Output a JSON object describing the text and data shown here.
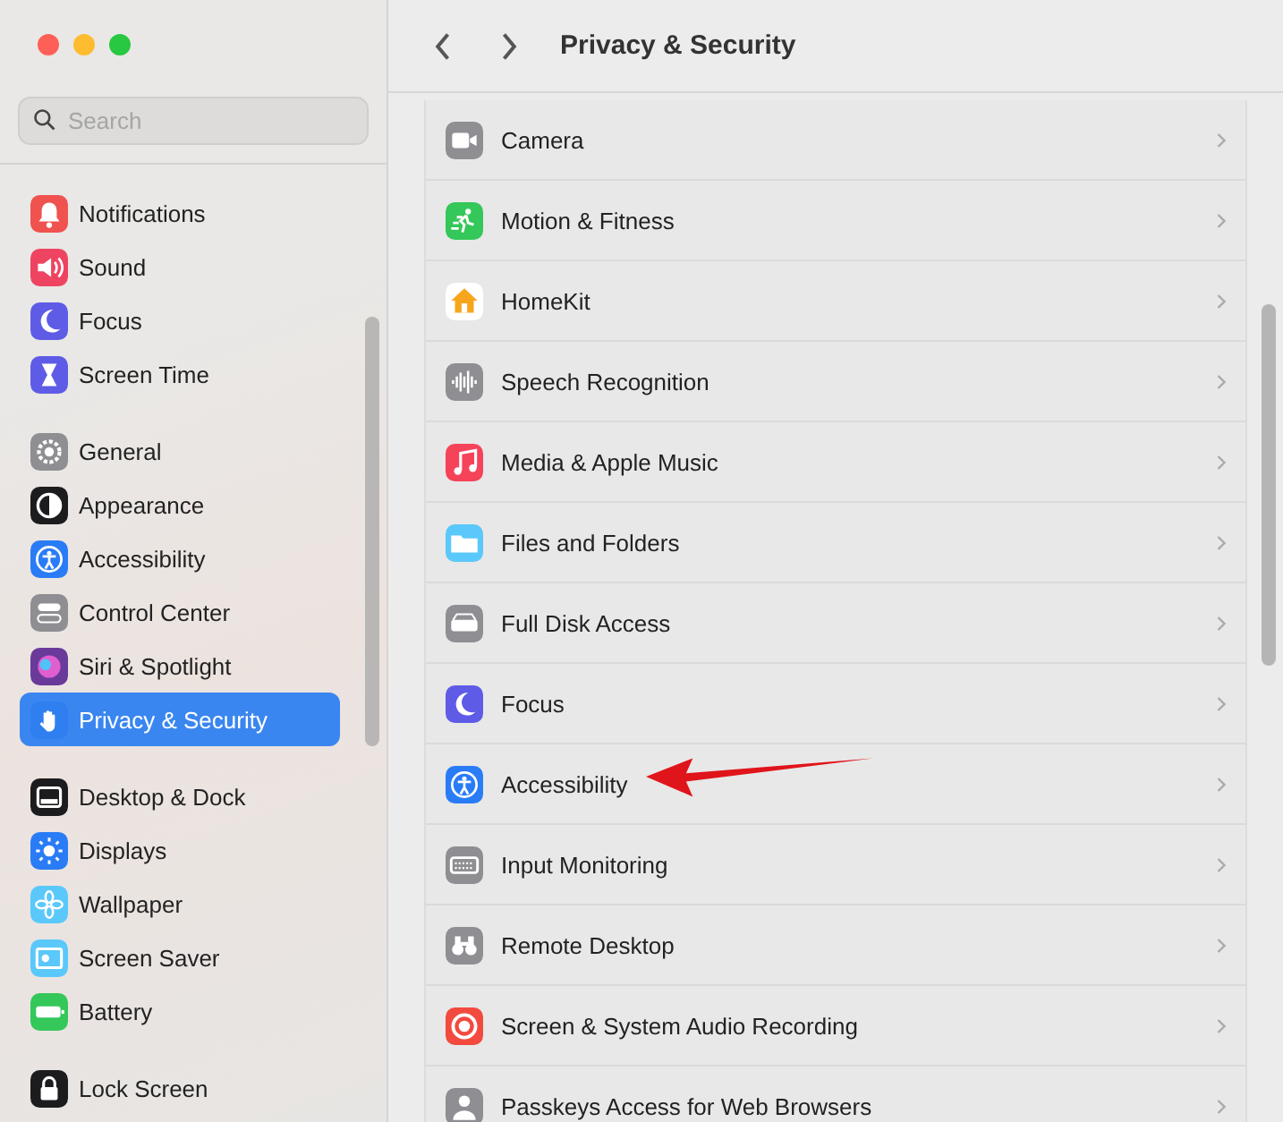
{
  "sidebar": {
    "search": {
      "placeholder": "Search"
    },
    "groups": [
      {
        "items": [
          {
            "label": "Notifications",
            "color": "#f0524f",
            "selected": false
          },
          {
            "label": "Sound",
            "color": "#ef4461",
            "selected": false
          },
          {
            "label": "Focus",
            "color": "#5e5ce6",
            "selected": false
          },
          {
            "label": "Screen Time",
            "color": "#5e5ce6",
            "selected": false
          }
        ]
      },
      {
        "items": [
          {
            "label": "General",
            "color": "#8e8e93",
            "selected": false
          },
          {
            "label": "Appearance",
            "color": "#1c1c1e",
            "selected": false
          },
          {
            "label": "Accessibility",
            "color": "#2a7cf6",
            "selected": false
          },
          {
            "label": "Control Center",
            "color": "#8e8e93",
            "selected": false
          },
          {
            "label": "Siri & Spotlight",
            "color": "#6a3a9a",
            "selected": false
          },
          {
            "label": "Privacy & Security",
            "color": "#2f7ff0",
            "selected": true
          }
        ]
      },
      {
        "items": [
          {
            "label": "Desktop & Dock",
            "color": "#1c1c1e",
            "selected": false
          },
          {
            "label": "Displays",
            "color": "#2a7cf6",
            "selected": false
          },
          {
            "label": "Wallpaper",
            "color": "#5ac8fa",
            "selected": false
          },
          {
            "label": "Screen Saver",
            "color": "#5ac8fa",
            "selected": false
          },
          {
            "label": "Battery",
            "color": "#34c759",
            "selected": false
          }
        ]
      },
      {
        "items": [
          {
            "label": "Lock Screen",
            "color": "#1c1c1e",
            "selected": false
          }
        ]
      }
    ]
  },
  "header": {
    "title": "Privacy & Security"
  },
  "rows": [
    {
      "label": "Camera",
      "color": "#8e8e93"
    },
    {
      "label": "Motion & Fitness",
      "color": "#34c759"
    },
    {
      "label": "HomeKit",
      "color": "#ffffff"
    },
    {
      "label": "Speech Recognition",
      "color": "#8e8e93"
    },
    {
      "label": "Media & Apple Music",
      "color": "#f5435a"
    },
    {
      "label": "Files and Folders",
      "color": "#5ac8fa"
    },
    {
      "label": "Full Disk Access",
      "color": "#8e8e93"
    },
    {
      "label": "Focus",
      "color": "#5e5ce6"
    },
    {
      "label": "Accessibility",
      "color": "#2a7cf6"
    },
    {
      "label": "Input Monitoring",
      "color": "#8e8e93"
    },
    {
      "label": "Remote Desktop",
      "color": "#8e8e93"
    },
    {
      "label": "Screen & System Audio Recording",
      "color": "#f34a3f"
    },
    {
      "label": "Passkeys Access for Web Browsers",
      "color": "#8e8e93"
    }
  ]
}
